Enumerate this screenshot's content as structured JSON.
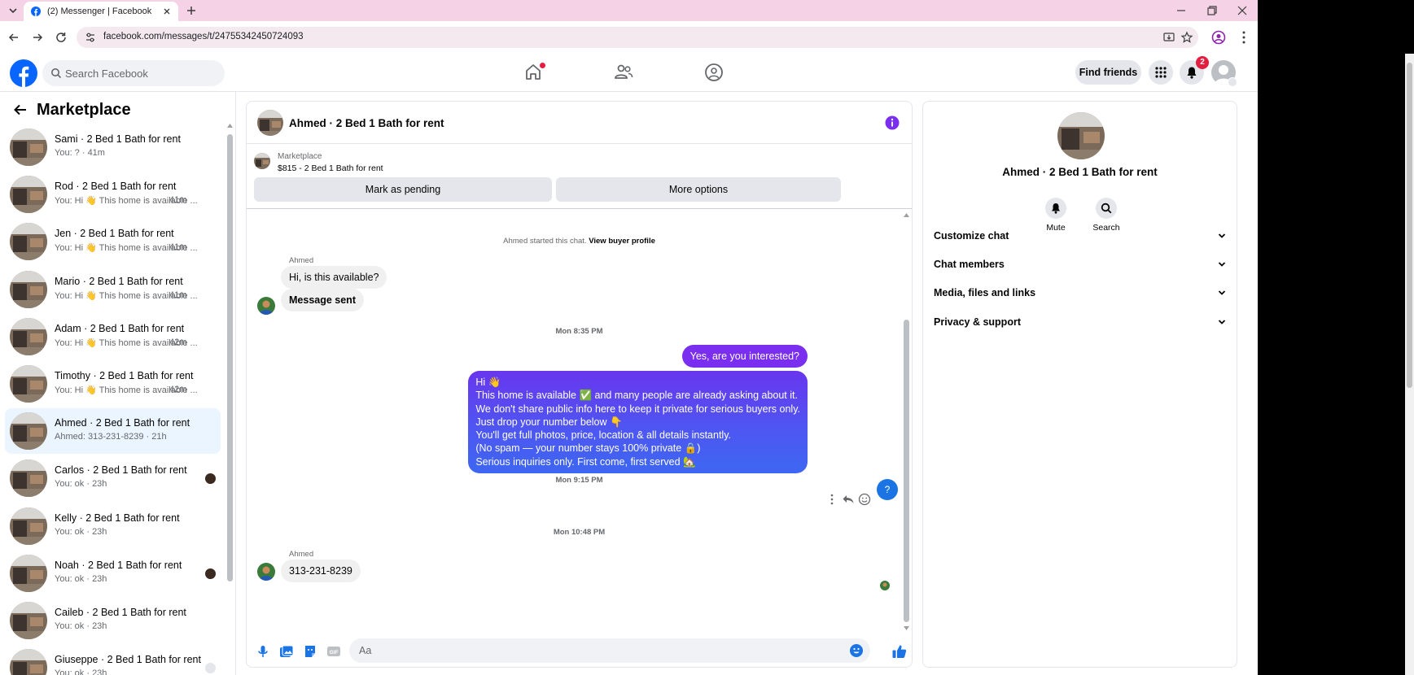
{
  "browser": {
    "tab_title": "(2) Messenger | Facebook",
    "url": "facebook.com/messages/t/24755342450724093"
  },
  "topbar": {
    "search_placeholder": "Search Facebook",
    "find_friends": "Find friends",
    "notification_count": "2"
  },
  "sidebar": {
    "title": "Marketplace",
    "conversations": [
      {
        "name": "Sami · 2 Bed 1 Bath for rent",
        "preview": "You: ? · 41m",
        "active": false
      },
      {
        "name": "Rod · 2 Bed 1 Bath for rent",
        "preview": "You: Hi 👋 This home is available ...",
        "time": "41m",
        "active": false
      },
      {
        "name": "Jen · 2 Bed 1 Bath for rent",
        "preview": "You: Hi 👋 This home is available ...",
        "time": "41m",
        "active": false
      },
      {
        "name": "Mario · 2 Bed 1 Bath for rent",
        "preview": "You: Hi 👋 This home is available ...",
        "time": "41m",
        "active": false
      },
      {
        "name": "Adam · 2 Bed 1 Bath for rent",
        "preview": "You: Hi 👋 This home is available ...",
        "time": "42m",
        "active": false
      },
      {
        "name": "Timothy · 2 Bed 1 Bath for rent",
        "preview": "You: Hi 👋 This home is available ...",
        "time": "42m",
        "active": false
      },
      {
        "name": "Ahmed · 2 Bed 1 Bath for rent",
        "preview": "Ahmed: 313-231-8239 · 21h",
        "active": true
      },
      {
        "name": "Carlos · 2 Bed 1 Bath for rent",
        "preview": "You: ok · 23h",
        "active": false
      },
      {
        "name": "Kelly · 2 Bed 1 Bath for rent",
        "preview": "You: ok · 23h",
        "active": false
      },
      {
        "name": "Noah · 2 Bed 1 Bath for rent",
        "preview": "You: ok · 23h",
        "active": false
      },
      {
        "name": "Caileb · 2 Bed 1 Bath for rent",
        "preview": "You: ok · 23h",
        "active": false
      },
      {
        "name": "Giuseppe · 2 Bed 1 Bath for rent",
        "preview": "You: ok · 23h",
        "active": false
      }
    ]
  },
  "chat": {
    "header_name": "Ahmed · 2 Bed 1 Bath for rent",
    "listing_source": "Marketplace",
    "listing_title": "$815 - 2 Bed 1 Bath for rent",
    "mark_pending": "Mark as pending",
    "more_options": "More options",
    "system_prefix": "Ahmed started this chat.",
    "system_link": "View buyer profile",
    "sender_name": "Ahmed",
    "msg_available": "Hi, is this available?",
    "msg_sent": "Message sent",
    "time_1": "Mon 8:35 PM",
    "msg_interested": "Yes, are you interested?",
    "long_message": [
      "Hi 👋",
      "This home is available ✅ and many people are already asking about it.",
      "We don't share public info here to keep it private for serious buyers only.",
      "Just drop your number below 👇",
      "You'll get full photos, price, location & all details instantly.",
      "(No spam — your number stays 100% private 🔒)",
      "Serious inquiries only. First come, first served 🏡"
    ],
    "time_2": "Mon 9:15 PM",
    "outgoing_question": "?",
    "time_3": "Mon 10:48 PM",
    "msg_phone": "313-231-8239",
    "composer_placeholder": "Aa"
  },
  "details": {
    "name": "Ahmed · 2 Bed 1 Bath for rent",
    "mute": "Mute",
    "search": "Search",
    "sections": [
      "Customize chat",
      "Chat members",
      "Media, files and links",
      "Privacy & support"
    ]
  },
  "colors": {
    "accent": "#7a2ff0",
    "facebook_blue": "#0866ff",
    "notification_red": "#e41e3f"
  }
}
